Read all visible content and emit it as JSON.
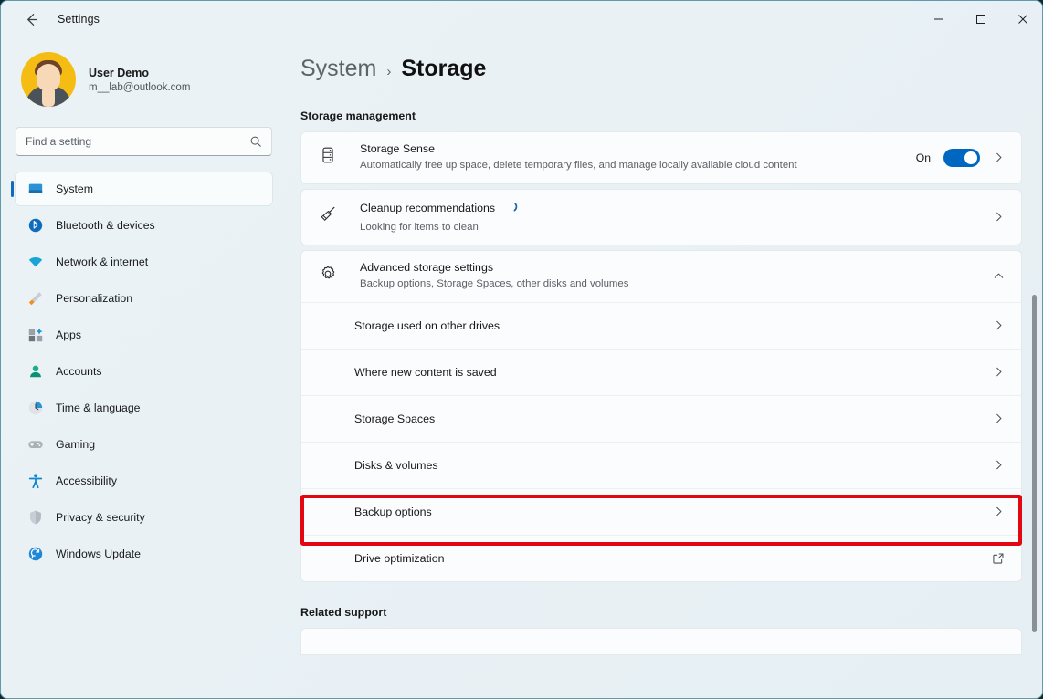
{
  "window": {
    "app_title": "Settings",
    "back_icon": "back-arrow-icon",
    "minimize_label": "—",
    "maximize_label": "☐",
    "close_label": "✕"
  },
  "sidebar": {
    "profile": {
      "name": "User Demo",
      "email": "m__lab@outlook.com"
    },
    "search": {
      "placeholder": "Find a setting",
      "value": "",
      "icon": "search-icon"
    },
    "items": [
      {
        "label": "System",
        "icon": "monitor-icon",
        "selected": true
      },
      {
        "label": "Bluetooth & devices",
        "icon": "bluetooth-icon",
        "selected": false
      },
      {
        "label": "Network & internet",
        "icon": "wifi-icon",
        "selected": false
      },
      {
        "label": "Personalization",
        "icon": "paintbrush-icon",
        "selected": false
      },
      {
        "label": "Apps",
        "icon": "apps-icon",
        "selected": false
      },
      {
        "label": "Accounts",
        "icon": "person-icon",
        "selected": false
      },
      {
        "label": "Time & language",
        "icon": "clock-icon",
        "selected": false
      },
      {
        "label": "Gaming",
        "icon": "gamepad-icon",
        "selected": false
      },
      {
        "label": "Accessibility",
        "icon": "accessibility-icon",
        "selected": false
      },
      {
        "label": "Privacy & security",
        "icon": "shield-icon",
        "selected": false
      },
      {
        "label": "Windows Update",
        "icon": "update-icon",
        "selected": false
      }
    ]
  },
  "main": {
    "breadcrumb": {
      "parent": "System",
      "separator": "›",
      "current": "Storage"
    },
    "section_title": "Storage management",
    "cards": [
      {
        "title": "Storage Sense",
        "subtitle": "Automatically free up space, delete temporary files, and manage locally available cloud content",
        "icon": "drive-stack-icon",
        "toggle_label": "On",
        "toggle_state": "on",
        "chevron": "chevron-right-icon"
      },
      {
        "title": "Cleanup recommendations",
        "subtitle": "Looking for items to clean",
        "icon": "broom-icon",
        "spinner": "progress-ring-icon",
        "chevron": "chevron-right-icon"
      }
    ],
    "advanced": {
      "title": "Advanced storage settings",
      "subtitle": "Backup options, Storage Spaces, other disks and volumes",
      "icon": "gear-icon",
      "chevron": "chevron-up-icon",
      "expanded": true,
      "sub_items": [
        {
          "label": "Storage used on other drives",
          "trailing": "chevron-right-icon",
          "highlighted": false
        },
        {
          "label": "Where new content is saved",
          "trailing": "chevron-right-icon",
          "highlighted": false
        },
        {
          "label": "Storage Spaces",
          "trailing": "chevron-right-icon",
          "highlighted": false
        },
        {
          "label": "Disks & volumes",
          "trailing": "chevron-right-icon",
          "highlighted": true
        },
        {
          "label": "Backup options",
          "trailing": "chevron-right-icon",
          "highlighted": false
        },
        {
          "label": "Drive optimization",
          "trailing": "external-link-icon",
          "highlighted": false
        }
      ]
    },
    "related_support": "Related support"
  },
  "colors": {
    "accent": "#0067c0",
    "highlight": "#e30613",
    "page_bg": "#eaf2f6",
    "card_bg": "#fbfcfd"
  }
}
